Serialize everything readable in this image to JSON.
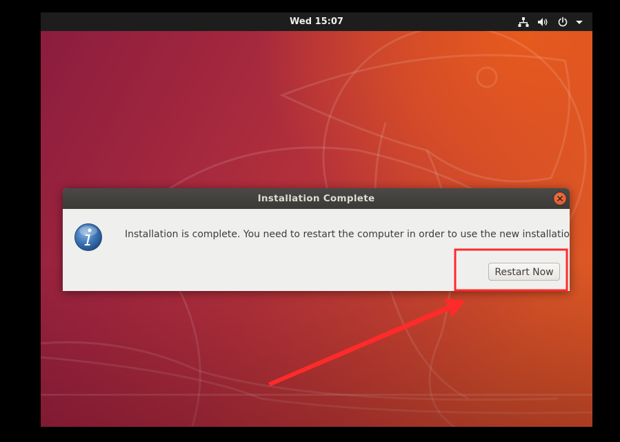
{
  "topbar": {
    "clock": "Wed 15:07",
    "icons": [
      "network-icon",
      "volume-icon",
      "power-icon",
      "menu-arrow-icon"
    ]
  },
  "dialog": {
    "title": "Installation Complete",
    "message": "Installation is complete. You need to restart the computer in order to use the new installation.",
    "restart_label": "Restart Now",
    "icon": "info-icon"
  },
  "annotation": {
    "color": "#ff2a2a",
    "highlight": "restart-button"
  },
  "colors": {
    "topbar": "#1d1d1d",
    "dialog_titlebar": "#3b3a37",
    "dialog_body": "#efefee",
    "close_button": "#e0582a",
    "wallpaper_start": "#8a1c3e",
    "wallpaper_end": "#e45c22"
  }
}
